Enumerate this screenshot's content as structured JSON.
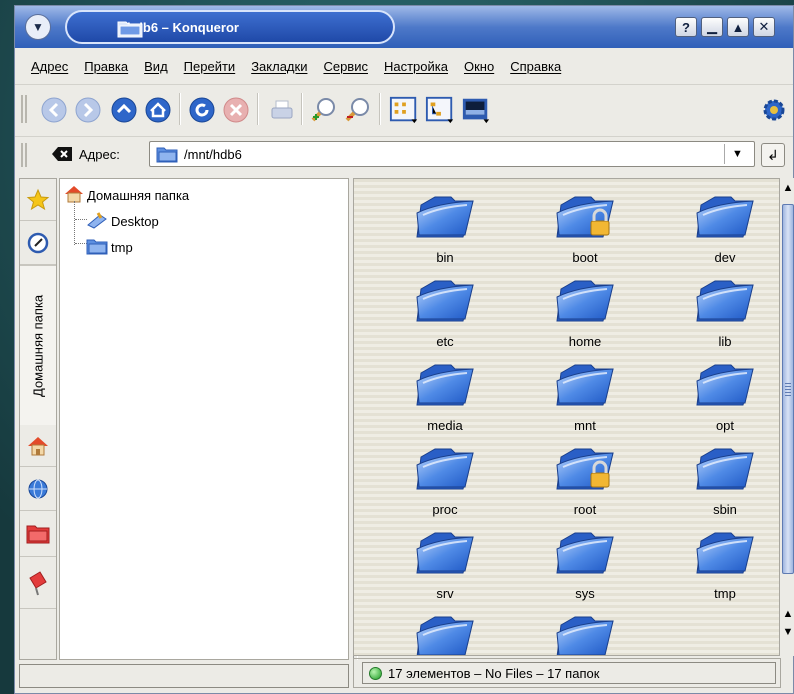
{
  "window": {
    "title": "hdb6 – Konqueror",
    "help_symbol": "?",
    "minimize_symbol": "▁",
    "maximize_symbol": "▲",
    "close_symbol": "✕",
    "menu_symbol": "▼"
  },
  "menubar": {
    "items": [
      "Адрес",
      "Правка",
      "Вид",
      "Перейти",
      "Закладки",
      "Сервис",
      "Настройка",
      "Окно",
      "Справка"
    ]
  },
  "toolbar": {
    "buttons": [
      "back-icon",
      "forward-icon",
      "up-icon",
      "home-icon",
      "reload-icon",
      "stop-icon",
      "print-icon",
      "zoom-in-icon",
      "zoom-out-icon",
      "icon-view-icon",
      "tree-view-icon",
      "preview-icon",
      "gear-icon"
    ]
  },
  "location": {
    "label": "Адрес:",
    "value": "/mnt/hdb6",
    "dropdown_symbol": "▼",
    "go_symbol": "↲"
  },
  "sidebar": {
    "tabs": [
      "bookmarks-star-icon",
      "history-icon",
      "Домашняя папка",
      "home-icon",
      "network-icon",
      "root-folder-icon",
      "services-icon"
    ],
    "home_tab_label": "Домашняя папка"
  },
  "tree": {
    "root": "Домашняя папка",
    "children": [
      "Desktop",
      "tmp"
    ]
  },
  "files": [
    {
      "name": "bin",
      "locked": false
    },
    {
      "name": "boot",
      "locked": true
    },
    {
      "name": "dev",
      "locked": false
    },
    {
      "name": "etc",
      "locked": false
    },
    {
      "name": "home",
      "locked": false
    },
    {
      "name": "lib",
      "locked": false
    },
    {
      "name": "media",
      "locked": false
    },
    {
      "name": "mnt",
      "locked": false
    },
    {
      "name": "opt",
      "locked": false
    },
    {
      "name": "proc",
      "locked": false
    },
    {
      "name": "root",
      "locked": true
    },
    {
      "name": "sbin",
      "locked": false
    },
    {
      "name": "srv",
      "locked": false
    },
    {
      "name": "sys",
      "locked": false
    },
    {
      "name": "tmp",
      "locked": false
    },
    {
      "name": "",
      "locked": false
    },
    {
      "name": "",
      "locked": false
    }
  ],
  "status": {
    "text": "17 элементов – No Files – 17 папок",
    "led_color": "#1d9c24"
  },
  "colors": {
    "titlebar": "#2f5fb8",
    "folder_blue": "#3b7ae0",
    "window_bg": "#ecebe6"
  }
}
